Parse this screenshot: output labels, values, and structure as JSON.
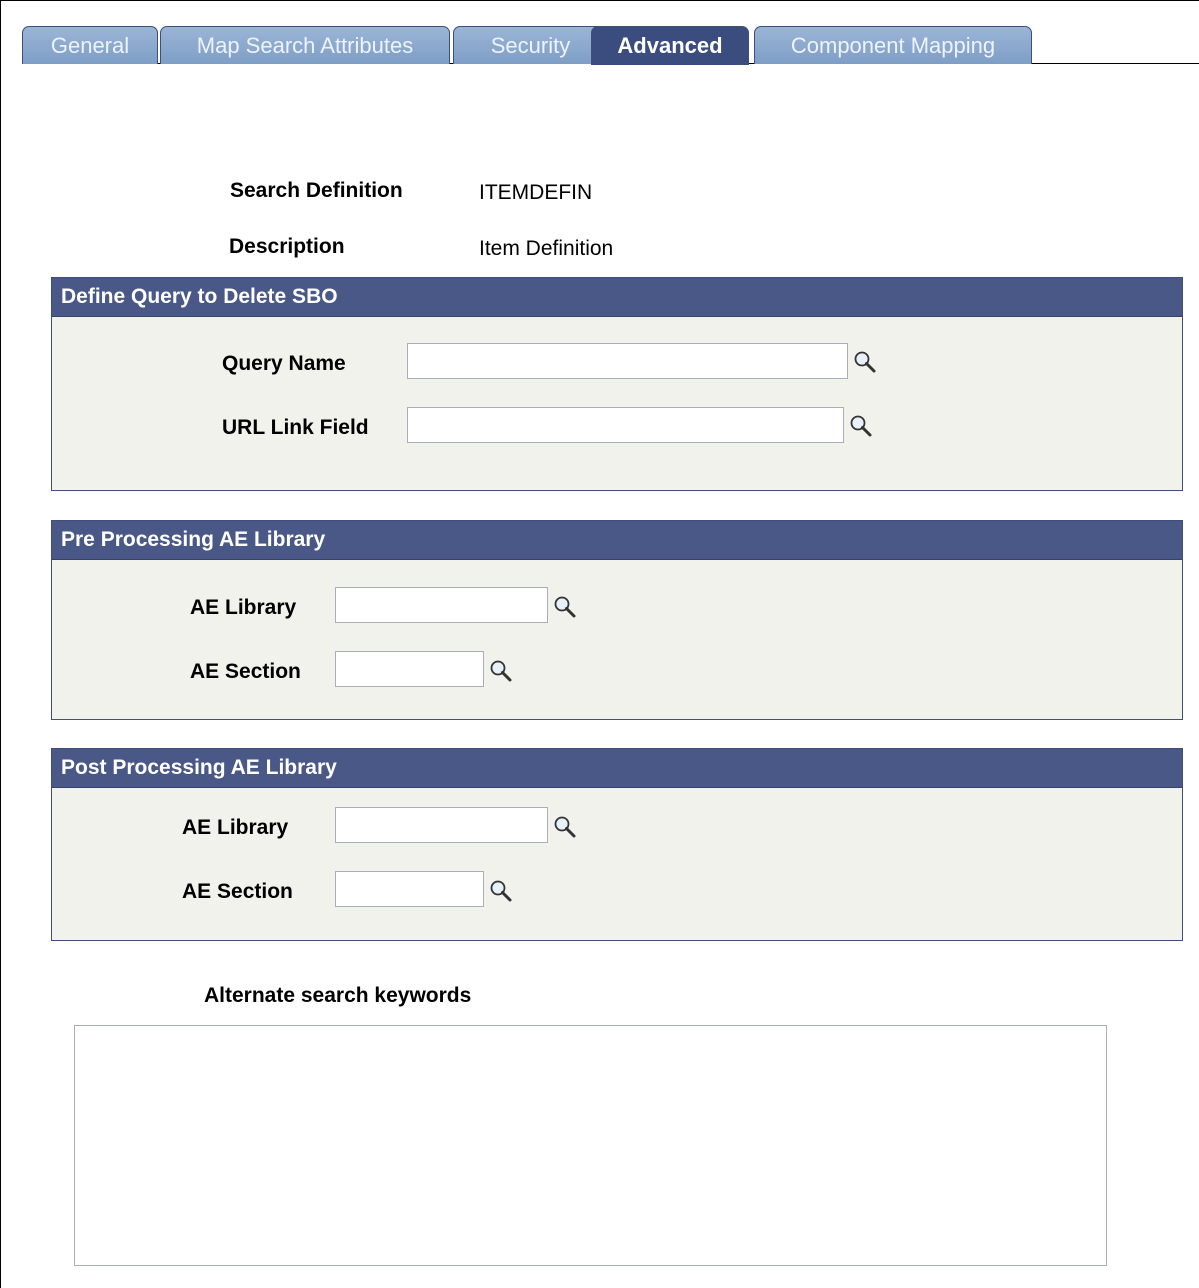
{
  "tabs": [
    {
      "label": "General"
    },
    {
      "label": "Map Search Attributes"
    },
    {
      "label": "Security"
    },
    {
      "label": "Advanced",
      "active": true
    },
    {
      "label": "Component Mapping"
    }
  ],
  "header": {
    "search_definition_label": "Search Definition",
    "search_definition_value": "ITEMDEFIN",
    "description_label": "Description",
    "description_value": "Item Definition"
  },
  "define_query": {
    "title": "Define Query to Delete SBO",
    "query_name_label": "Query Name",
    "query_name_value": "",
    "url_link_field_label": "URL Link Field",
    "url_link_field_value": ""
  },
  "pre_processing": {
    "title": "Pre Processing AE Library",
    "ae_library_label": "AE Library",
    "ae_library_value": "",
    "ae_section_label": "AE Section",
    "ae_section_value": ""
  },
  "post_processing": {
    "title": "Post Processing AE Library",
    "ae_library_label": "AE Library",
    "ae_library_value": "",
    "ae_section_label": "AE Section",
    "ae_section_value": ""
  },
  "alternate_keywords": {
    "label": "Alternate search keywords",
    "value": ""
  },
  "icons": {
    "lookup": "magnifier-icon"
  },
  "colors": {
    "tab": "#8aa7cd",
    "tab_active": "#3a4d7e",
    "group_header": "#4a5887",
    "group_body": "#f1f2ec"
  }
}
